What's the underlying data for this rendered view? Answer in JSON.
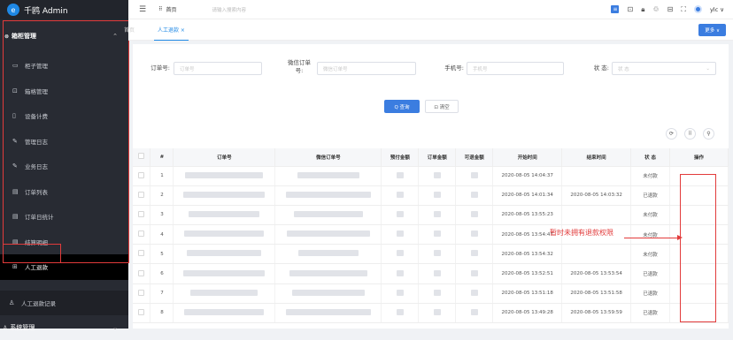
{
  "app": {
    "title": "千鸥 Admin",
    "logo_letter": "e"
  },
  "sidebar": {
    "group": "箱柜管理",
    "items": [
      {
        "label": "柜子管理",
        "icon": "monitor-icon"
      },
      {
        "label": "箱格管理",
        "icon": "image-icon"
      },
      {
        "label": "设备计费",
        "icon": "card-icon"
      },
      {
        "label": "管理日志",
        "icon": "edit-icon"
      },
      {
        "label": "业务日志",
        "icon": "edit-icon"
      },
      {
        "label": "订单列表",
        "icon": "doc-icon"
      },
      {
        "label": "订单日统计",
        "icon": "doc-icon"
      },
      {
        "label": "结算明细",
        "icon": "doc-icon"
      },
      {
        "label": "人工退款",
        "icon": "grid-icon"
      }
    ],
    "lower": [
      {
        "label": "人工退款记录"
      }
    ],
    "system": "系统管理"
  },
  "topbar": {
    "breadcrumb": "首页",
    "search_placeholder": "请输入搜索内容",
    "user": "ylc"
  },
  "tabs": [
    {
      "label": "首页"
    },
    {
      "label": "人工退款 ×"
    }
  ],
  "more_button": "更多 ∨",
  "filters": {
    "order_no_label": "订单号:",
    "order_no_placeholder": "订单号",
    "wechat_label_1": "微信订单",
    "wechat_label_2": "号:",
    "wechat_placeholder": "微信订单号",
    "phone_label": "手机号:",
    "phone_placeholder": "手机号",
    "status_label": "状 态:",
    "status_placeholder": "状 态"
  },
  "buttons": {
    "query": "Q 查询",
    "clear": "⊡ 清空"
  },
  "table": {
    "headers": [
      "#",
      "订单号",
      "微信订单号",
      "预付金额",
      "订单金额",
      "可退金额",
      "开始时间",
      "结束时间",
      "状 态",
      "操作"
    ],
    "rows": [
      {
        "n": "1",
        "start": "2020-08-05 14:04:37",
        "end": "",
        "status": "未付款"
      },
      {
        "n": "2",
        "start": "2020-08-05 14:01:34",
        "end": "2020-08-05 14:03:32",
        "status": "已退款"
      },
      {
        "n": "3",
        "start": "2020-08-05 13:55:23",
        "end": "",
        "status": "未付款"
      },
      {
        "n": "4",
        "start": "2020-08-05 13:54:47",
        "end": "",
        "status": "未付款"
      },
      {
        "n": "5",
        "start": "2020-08-05 13:54:32",
        "end": "",
        "status": "未付款"
      },
      {
        "n": "6",
        "start": "2020-08-05 13:52:51",
        "end": "2020-08-05 13:53:54",
        "status": "已退款"
      },
      {
        "n": "7",
        "start": "2020-08-05 13:51:18",
        "end": "2020-08-05 13:51:58",
        "status": "已退款"
      },
      {
        "n": "8",
        "start": "2020-08-05 13:49:28",
        "end": "2020-08-05 13:59:59",
        "status": "已退款"
      }
    ]
  },
  "annotation": {
    "note": "暂时未拥有退款权限"
  }
}
